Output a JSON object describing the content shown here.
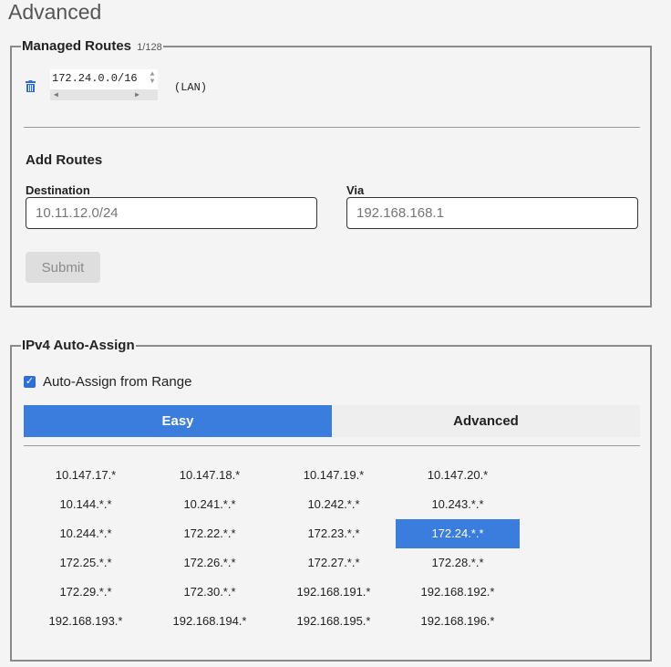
{
  "page": {
    "title": "Advanced"
  },
  "managed_routes": {
    "legend": "Managed Routes",
    "count": "1/128",
    "routes": [
      {
        "target": "172.24.0.0/16",
        "via": "(LAN)"
      }
    ],
    "add_heading": "Add Routes",
    "destination_label": "Destination",
    "destination_placeholder": "10.11.12.0/24",
    "via_label": "Via",
    "via_placeholder": "192.168.168.1",
    "submit_label": "Submit"
  },
  "ipv4": {
    "legend": "IPv4 Auto-Assign",
    "checkbox_label": "Auto-Assign from Range",
    "checkbox_checked": true,
    "tabs": [
      {
        "label": "Easy",
        "active": true
      },
      {
        "label": "Advanced",
        "active": false
      }
    ],
    "ranges": [
      [
        "10.147.17.*",
        "10.147.18.*",
        "10.147.19.*",
        "10.147.20.*"
      ],
      [
        "10.144.*.*",
        "10.241.*.*",
        "10.242.*.*",
        "10.243.*.*"
      ],
      [
        "10.244.*.*",
        "172.22.*.*",
        "172.23.*.*",
        "172.24.*.*"
      ],
      [
        "172.25.*.*",
        "172.26.*.*",
        "172.27.*.*",
        "172.28.*.*"
      ],
      [
        "172.29.*.*",
        "172.30.*.*",
        "192.168.191.*",
        "192.168.192.*"
      ],
      [
        "192.168.193.*",
        "192.168.194.*",
        "192.168.195.*",
        "192.168.196.*"
      ]
    ],
    "selected_range": "172.24.*.*"
  },
  "colors": {
    "accent": "#3a7ddd",
    "trash_icon": "#2e6fd8"
  }
}
